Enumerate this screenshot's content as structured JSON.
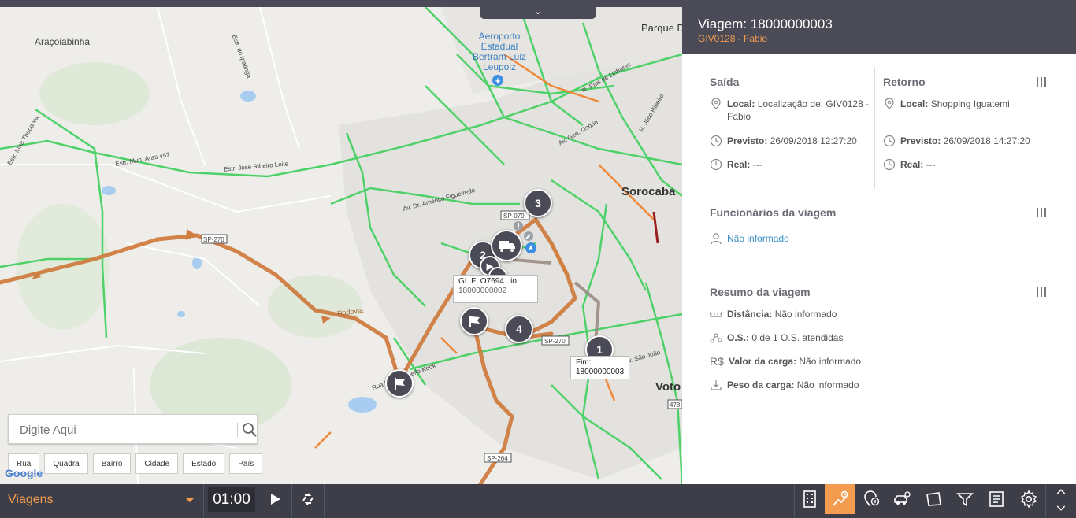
{
  "map": {
    "collapse_glyph": "⌄",
    "labels": {
      "aracoiabinha": "Araçoiabinha",
      "airport": "Aeroporto Estadual Bertram Luiz Leupolz",
      "sorocaba": "Sorocaba",
      "parque": "Parque Do",
      "votorantim": "Voto",
      "estr_mun": "Estr. Mun. Aras 457",
      "estr_jose": "Estr. José Ribeiro Leite",
      "av_americo": "Av. Dr. Américo Figueiredo",
      "av_gen": "Av. Gen. Osório",
      "rodovia": "Rodovia",
      "sp270_left": "SP-270",
      "sp270": "SP-270",
      "sp079": "SP-079",
      "sp264": "SP-264",
      "r478": "478",
      "r_laura": "Rua Laura Maiello Kook",
      "r_pais": "R. Pais de Linhares",
      "r_julio": "R. Júlio Ribeiro",
      "estr_ipatinga": "Estr. do Ipatinga",
      "irma": "Estr. Irmã Theodora",
      "av_sao_joao": "Av. São João"
    },
    "markers": {
      "m1": "1",
      "m2": "2",
      "m3": "3",
      "m4": "4"
    },
    "tip_vehicle_a": "GI",
    "tip_vehicle_b": "FLO7694",
    "tip_vehicle_c": "io",
    "tip_vehicle_d": "18000000002",
    "tip_end_label": "Fim:",
    "tip_end_value": "18000000003",
    "search_placeholder": "Digite Aqui",
    "chips": [
      "Rua",
      "Quadra",
      "Bairro",
      "Cidade",
      "Estado",
      "País"
    ],
    "google": "Google"
  },
  "panel": {
    "title": "Viagem: 18000000003",
    "subtitle": "GIV0128 - Fabio",
    "saida": {
      "title": "Saída",
      "local_label": "Local:",
      "local_value": "Localização de: GIV0128 - Fabio",
      "previsto_label": "Previsto:",
      "previsto_value": "26/09/2018 12:27:20",
      "real_label": "Real:",
      "real_value": "---"
    },
    "retorno": {
      "title": "Retorno",
      "local_label": "Local:",
      "local_value": "Shopping Iguatemi",
      "previsto_label": "Previsto:",
      "previsto_value": "26/09/2018 14:27:20",
      "real_label": "Real:",
      "real_value": "---"
    },
    "funcionarios": {
      "title": "Funcionários da viagem",
      "value": "Não informado"
    },
    "resumo": {
      "title": "Resumo da viagem",
      "distancia_label": "Distância:",
      "distancia_value": "Não informado",
      "os_label": "O.S.:",
      "os_value": "0 de 1 O.S. atendidas",
      "valor_label": "Valor da carga:",
      "valor_value": "Não informado",
      "peso_label": "Peso da carga:",
      "peso_value": "Não informado"
    }
  },
  "bottombar": {
    "module": "Viagens",
    "time": "01:00",
    "icons": [
      "building-icon",
      "trip-icon",
      "location-info-icon",
      "vehicle-icon",
      "polygon-icon",
      "route-icon",
      "report-icon",
      "gear-icon"
    ],
    "active_index": 1
  },
  "colors": {
    "header": "#4a4b56",
    "accent": "#f39c50",
    "link": "#3a8fc7"
  }
}
